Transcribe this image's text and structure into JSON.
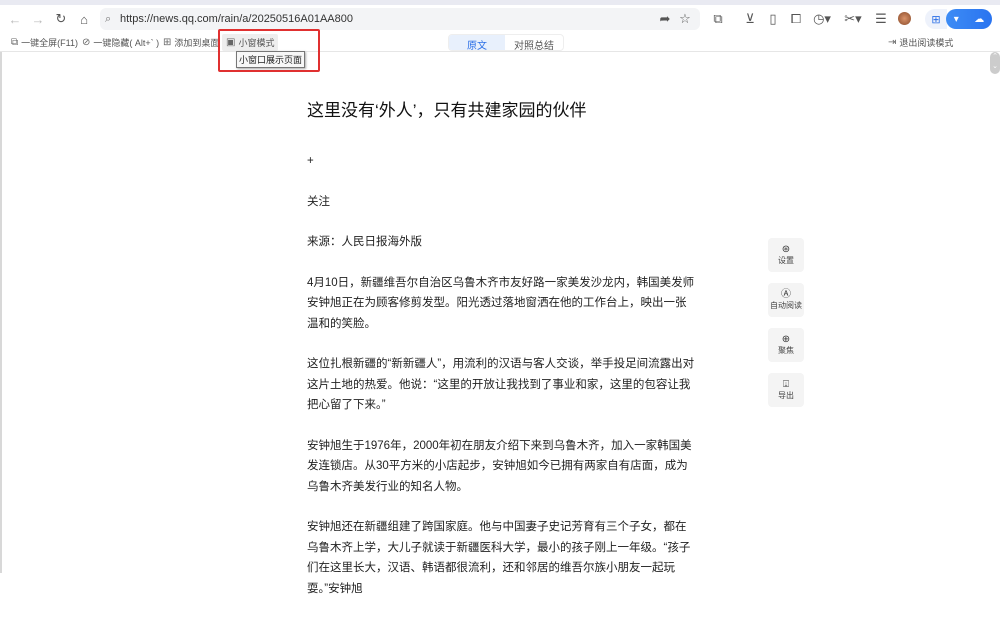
{
  "browser": {
    "url": "https://news.qq.com/rain/a/20250516A01AA800"
  },
  "toolbar": {
    "fullscreen": "一键全屏(F11)",
    "hide": "一键隐藏( Alt+` )",
    "add_desktop": "添加到桌面",
    "small_window": "小窗模式",
    "tooltip": "小窗口展示页面",
    "tab_original": "原文",
    "tab_compare": "对照总结",
    "exit_reading": "退出阅读模式"
  },
  "article": {
    "title": "这里没有‘外人’，只有共建家园的伙伴",
    "plus": "+",
    "follow": "关注",
    "source": "来源：人民日报海外版",
    "paragraphs": [
      "4月10日，新疆维吾尔自治区乌鲁木齐市友好路一家美发沙龙内，韩国美发师安钟旭正在为顾客修剪发型。阳光透过落地窗洒在他的工作台上，映出一张温和的笑脸。",
      "这位扎根新疆的“新新疆人”，用流利的汉语与客人交谈，举手投足间流露出对这片土地的热爱。他说：“这里的开放让我找到了事业和家，这里的包容让我把心留了下来。”",
      "安钟旭生于1976年，2000年初在朋友介绍下来到乌鲁木齐，加入一家韩国美发连锁店。从30平方米的小店起步，安钟旭如今已拥有两家自有店面，成为乌鲁木齐美发行业的知名人物。",
      "安钟旭还在新疆组建了跨国家庭。他与中国妻子史记芳育有三个子女，都在乌鲁木齐上学，大儿子就读于新疆医科大学，最小的孩子刚上一年级。“孩子们在这里长大，汉语、韩语都很流利，还和邻居的维吾尔族小朋友一起玩耍。”安钟旭"
    ]
  },
  "side": {
    "settings": "设置",
    "auto_read": "自动阅读",
    "focus": "聚焦",
    "export": "导出"
  }
}
